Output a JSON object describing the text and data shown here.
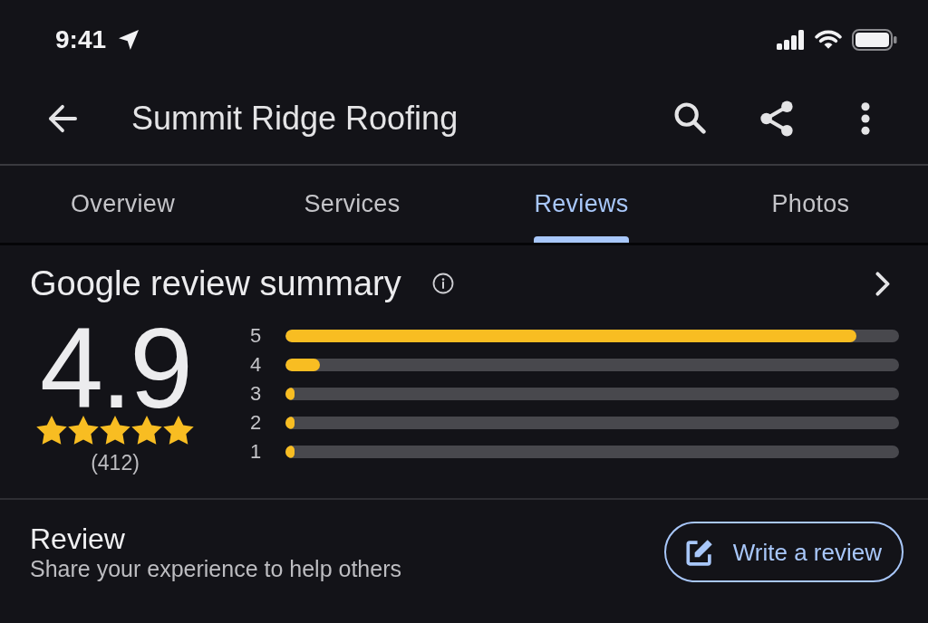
{
  "status_bar": {
    "time": "9:41"
  },
  "app_bar": {
    "title": "Summit Ridge Roofing"
  },
  "tabs": [
    {
      "label": "Overview",
      "selected": false
    },
    {
      "label": "Services",
      "selected": false
    },
    {
      "label": "Reviews",
      "selected": true
    },
    {
      "label": "Photos",
      "selected": false
    }
  ],
  "summary": {
    "title": "Google review summary",
    "rating": "4.9",
    "stars": 5,
    "count": "(412)",
    "distribution": [
      {
        "label": "5",
        "level": 0.93
      },
      {
        "label": "4",
        "level": 0.056
      },
      {
        "label": "3",
        "level": 0.015
      },
      {
        "label": "2",
        "level": 0.015
      },
      {
        "label": "1",
        "level": 0.015
      }
    ]
  },
  "review": {
    "title": "Review",
    "subtitle": "Share your experience to help others",
    "button": "Write a review"
  }
}
